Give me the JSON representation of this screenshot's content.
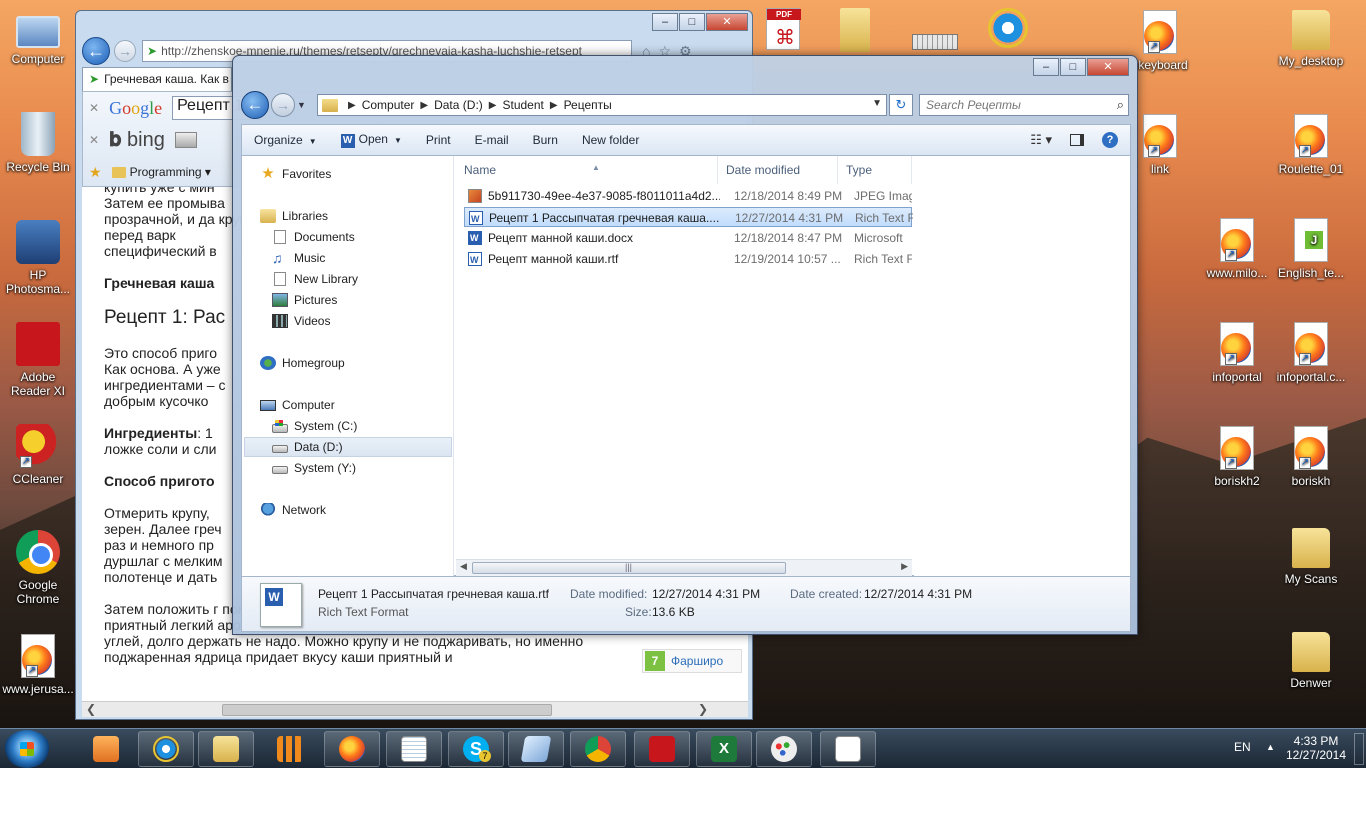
{
  "desktop": {
    "left_icons": [
      {
        "label": "Computer",
        "icon": "computer-icon"
      },
      {
        "label": "Recycle Bin",
        "icon": "recycle-bin-icon"
      },
      {
        "label": "HP Photosma...",
        "icon": "hp-photosmart-icon"
      },
      {
        "label": "Adobe Reader XI",
        "icon": "adobe-reader-icon"
      },
      {
        "label": "CCleaner",
        "icon": "ccleaner-icon"
      },
      {
        "label": "Google Chrome",
        "icon": "chrome-icon"
      },
      {
        "label": "www.jerusa...",
        "icon": "firefox-shortcut-icon"
      }
    ],
    "right_icons": [
      {
        "label": "skeyboard",
        "icon": "firefox-shortcut-icon"
      },
      {
        "label": "My_desktop",
        "icon": "folder-icon"
      },
      {
        "label": "link",
        "icon": "firefox-shortcut-icon"
      },
      {
        "label": "Roulette_01",
        "icon": "firefox-shortcut-icon"
      },
      {
        "label": "www.milo...",
        "icon": "firefox-shortcut-icon"
      },
      {
        "label": "English_te...",
        "icon": "document-icon"
      },
      {
        "label": "infoportal",
        "icon": "firefox-shortcut-icon"
      },
      {
        "label": "infoportal.c...",
        "icon": "firefox-shortcut-icon"
      },
      {
        "label": "boriskh2",
        "icon": "firefox-shortcut-icon"
      },
      {
        "label": "boriskh",
        "icon": "firefox-shortcut-icon"
      },
      {
        "label": "My Scans",
        "icon": "folder-icon"
      },
      {
        "label": "Denwer",
        "icon": "folder-icon"
      }
    ],
    "top_icons": [
      {
        "icon": "pdf-icon",
        "badge": "PDF"
      },
      {
        "icon": "folder-icon"
      },
      {
        "icon": "keyboard-icon"
      },
      {
        "icon": "ie-icon"
      }
    ]
  },
  "ie": {
    "url": "http://zhenskoe-mnenie.ru/themes/retsepty/grechnevaja-kasha-luchshie-retsept",
    "tab_title": "Гречневая каша. Как в",
    "google_search_value": "Рецепт 1",
    "bing_label": "bing",
    "favorites_folder": "Programming",
    "article": {
      "p1": "купить уже с мин",
      "p2": "Затем ее промыва прозрачной, и да крупу перед варк специфический в",
      "h3": "Гречневая каша",
      "h2": "Рецепт 1: Рас",
      "p3": "Это способ приго Как основа. А уже ингредиентами – с добрым кусочко",
      "ingredients_label": "Ингредиенты",
      "ingredients_text": ": 1 ложке соли и сли",
      "method_label": "Способ пригото",
      "p4": "Отмерить крупу, зерен. Далее греч раз и немного пр дуршлаг с мелким полотенце и дать",
      "p5": "Затем положить г помешивая, пока крупа не станет золотистой и не появится приятный легкий аромат жареного зерна. Следите, чтобы крупа не пригорела до углей, долго держать не надо. Можно крупу и не поджаривать, но именно поджаренная ядрица придает вкусу каши приятный и"
    },
    "ad": {
      "num": "7",
      "text": "Фарширо"
    }
  },
  "explorer": {
    "breadcrumb": [
      "Computer",
      "Data (D:)",
      "Student",
      "Рецепты"
    ],
    "search_placeholder": "Search Рецепты",
    "commands": {
      "organize": "Organize",
      "open": "Open",
      "print": "Print",
      "email": "E-mail",
      "burn": "Burn",
      "new_folder": "New folder"
    },
    "nav": {
      "favorites": "Favorites",
      "libraries": "Libraries",
      "documents": "Documents",
      "music": "Music",
      "new_library": "New Library",
      "pictures": "Pictures",
      "videos": "Videos",
      "homegroup": "Homegroup",
      "computer": "Computer",
      "system_c": "System (C:)",
      "data_d": "Data (D:)",
      "system_y": "System (Y:)",
      "network": "Network"
    },
    "columns": {
      "name": "Name",
      "date": "Date modified",
      "type": "Type"
    },
    "files": [
      {
        "name": "5b911730-49ee-4e37-9085-f8011011a4d2....",
        "date": "12/18/2014 8:49 PM",
        "type": "JPEG Imag",
        "icon": "jpeg-file-icon"
      },
      {
        "name": "Рецепт 1 Рассыпчатая гречневая каша....",
        "date": "12/27/2014 4:31 PM",
        "type": "Rich Text F",
        "icon": "rtf-file-icon",
        "selected": true
      },
      {
        "name": "Рецепт манной каши.docx",
        "date": "12/18/2014 8:47 PM",
        "type": "Microsoft",
        "icon": "docx-file-icon"
      },
      {
        "name": "Рецепт манной каши.rtf",
        "date": "12/19/2014 10:57 ...",
        "type": "Rich Text F",
        "icon": "rtf-file-icon"
      }
    ],
    "details": {
      "name": "Рецепт 1 Рассыпчатая гречневая каша.rtf",
      "type": "Rich Text Format",
      "modified_label": "Date modified:",
      "modified_value": "12/27/2014 4:31 PM",
      "created_label": "Date created:",
      "created_value": "12/27/2014 4:31 PM",
      "size_label": "Size:",
      "size_value": "13.6 KB"
    }
  },
  "taskbar": {
    "language": "EN",
    "time": "4:33 PM",
    "date": "12/27/2014",
    "skype_badge": "7"
  }
}
